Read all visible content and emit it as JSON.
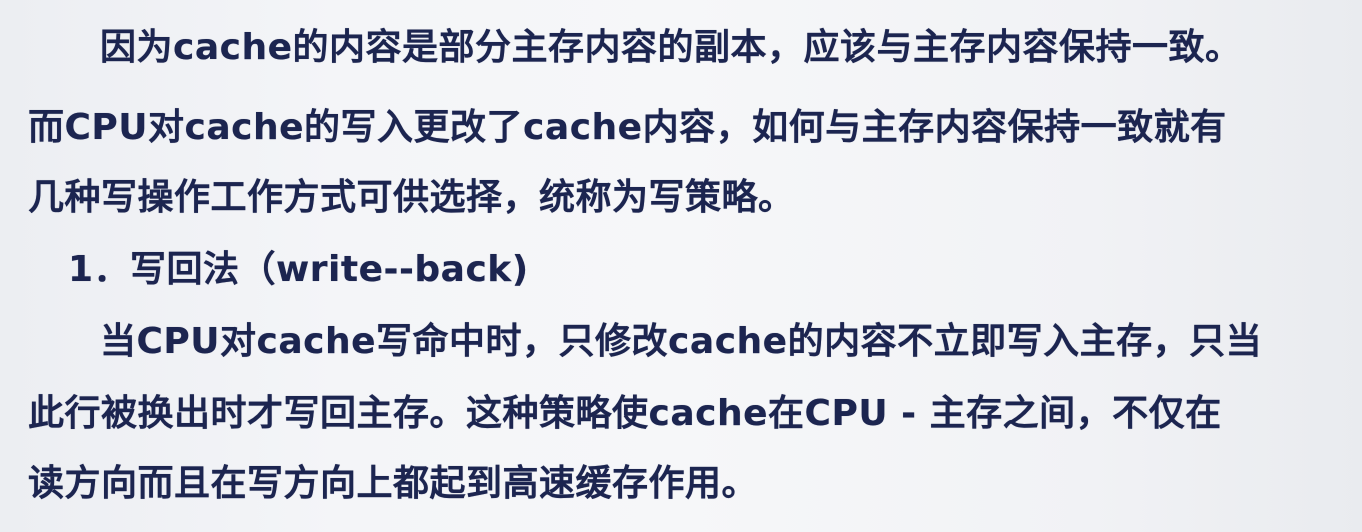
{
  "slide": {
    "paragraph_intro": {
      "line1": "因为cache的内容是部分主存内容的副本，应该与主存内容保持一致。",
      "line2": "而CPU对cache的写入更改了cache内容，如何与主存内容保持一致就有",
      "line3": "几种写操作工作方式可供选择，统称为写策略。"
    },
    "section_heading": "1．写回法（write--back)",
    "paragraph_writeback": {
      "line1": "当CPU对cache写命中时，只修改cache的内容不立即写入主存，只当",
      "line2": "此行被换出时才写回主存。这种策略使cache在CPU - 主存之间，不仅在",
      "line3": "读方向而且在写方向上都起到高速缓存作用。"
    },
    "colors": {
      "text": "#1c2550",
      "background": "#f4f5f8"
    }
  }
}
